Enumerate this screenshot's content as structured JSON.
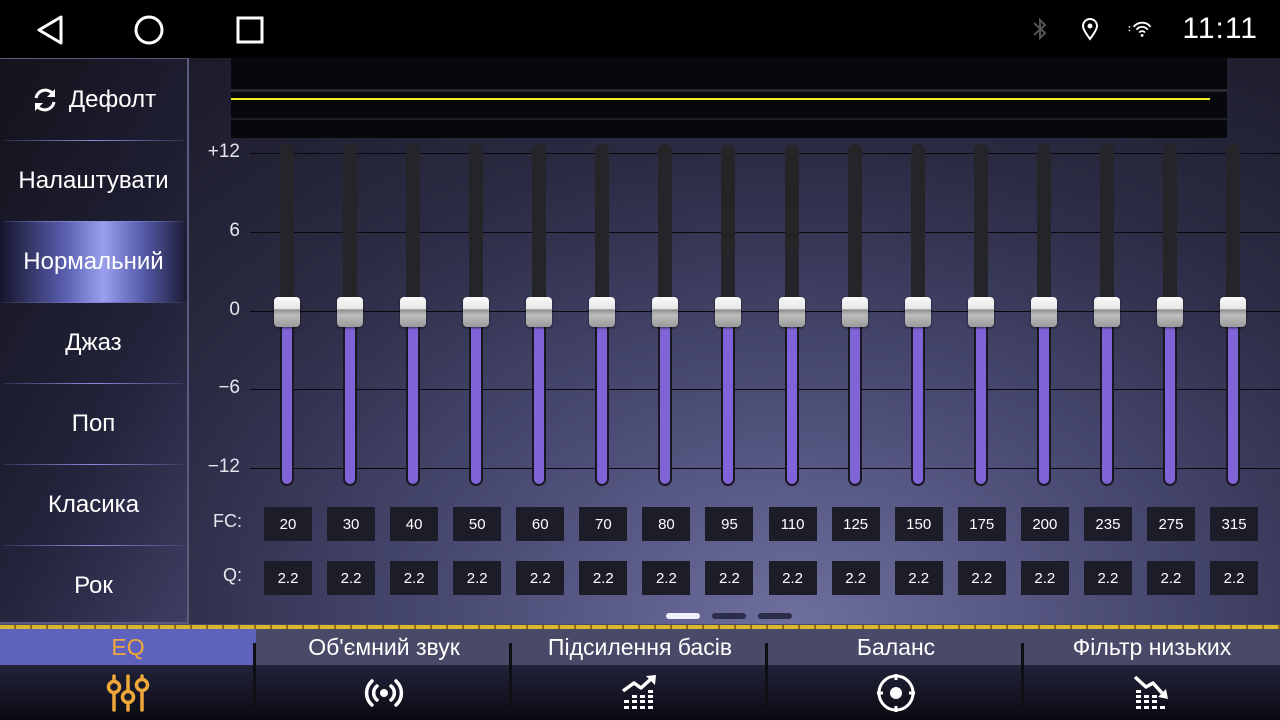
{
  "statusbar": {
    "nav": [
      {
        "name": "back",
        "icon": "back-triangle-icon"
      },
      {
        "name": "home",
        "icon": "home-circle-icon"
      },
      {
        "name": "recents",
        "icon": "recents-square-icon"
      }
    ],
    "icons": [
      "bluetooth-icon",
      "location-icon",
      "wifi-icon"
    ],
    "time": "11:11"
  },
  "presets": {
    "items": [
      {
        "label": "Дефолт",
        "icon": "refresh-icon",
        "active": false
      },
      {
        "label": "Налаштувати",
        "active": false
      },
      {
        "label": "Нормальний",
        "active": true
      },
      {
        "label": "Джаз",
        "active": false
      },
      {
        "label": "Поп",
        "active": false
      },
      {
        "label": "Класика",
        "active": false
      },
      {
        "label": "Рок",
        "active": false
      }
    ]
  },
  "equalizer": {
    "curve_color": "#f2ee22",
    "axis": {
      "ticks": [
        "+12",
        "6",
        "0",
        "−6",
        "−12"
      ],
      "range": [
        -12,
        12
      ]
    },
    "fc_label": "FC:",
    "q_label": "Q:",
    "bands": [
      {
        "fc": "20",
        "q": "2.2",
        "gain": 0
      },
      {
        "fc": "30",
        "q": "2.2",
        "gain": 0
      },
      {
        "fc": "40",
        "q": "2.2",
        "gain": 0
      },
      {
        "fc": "50",
        "q": "2.2",
        "gain": 0
      },
      {
        "fc": "60",
        "q": "2.2",
        "gain": 0
      },
      {
        "fc": "70",
        "q": "2.2",
        "gain": 0
      },
      {
        "fc": "80",
        "q": "2.2",
        "gain": 0
      },
      {
        "fc": "95",
        "q": "2.2",
        "gain": 0
      },
      {
        "fc": "110",
        "q": "2.2",
        "gain": 0
      },
      {
        "fc": "125",
        "q": "2.2",
        "gain": 0
      },
      {
        "fc": "150",
        "q": "2.2",
        "gain": 0
      },
      {
        "fc": "175",
        "q": "2.2",
        "gain": 0
      },
      {
        "fc": "200",
        "q": "2.2",
        "gain": 0
      },
      {
        "fc": "235",
        "q": "2.2",
        "gain": 0
      },
      {
        "fc": "275",
        "q": "2.2",
        "gain": 0
      },
      {
        "fc": "315",
        "q": "2.2",
        "gain": 0
      }
    ],
    "pager": {
      "pages": 3,
      "current": 1
    },
    "fill_color": "#8063d6"
  },
  "tabs": [
    {
      "label": "EQ",
      "icon": "equalizer-sliders-icon",
      "active": true
    },
    {
      "label": "Об'ємний звук",
      "icon": "surround-sound-icon",
      "active": false
    },
    {
      "label": "Підсилення басів",
      "icon": "bass-boost-icon",
      "active": false
    },
    {
      "label": "Баланс",
      "icon": "balance-target-icon",
      "active": false
    },
    {
      "label": "Фільтр низьких",
      "icon": "low-pass-filter-icon",
      "active": false
    }
  ],
  "colors": {
    "active_tab_text": "#f0a83a",
    "active_tab_bg": "#5f62bd",
    "accent_gold": "#d9b530"
  }
}
